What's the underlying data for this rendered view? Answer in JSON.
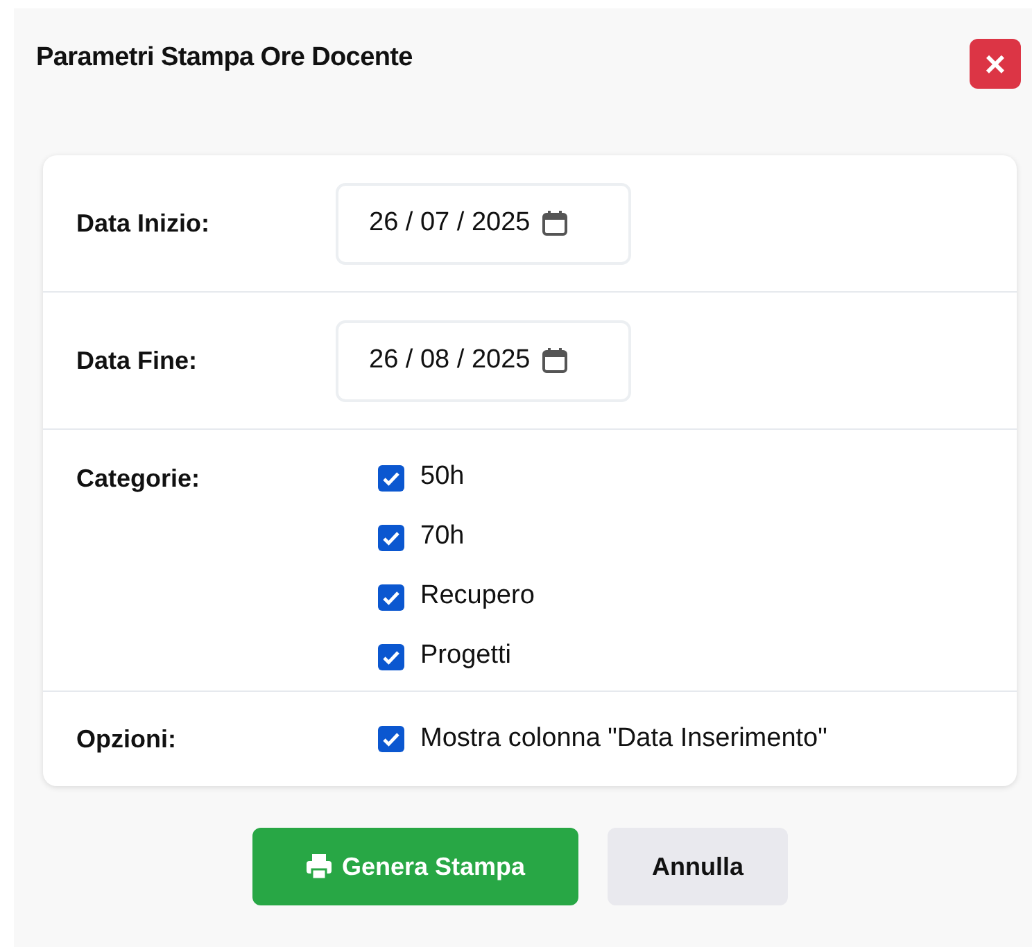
{
  "dialog": {
    "title": "Parametri Stampa Ore Docente",
    "close_label": "×"
  },
  "fields": [
    {
      "kind": "date",
      "label": "Data Inizio:",
      "value": "26 / 07 / 2025"
    },
    {
      "kind": "date",
      "label": "Data Fine:",
      "value": "26 / 08 / 2025"
    },
    {
      "kind": "checks",
      "label": "Categorie:",
      "options": [
        {
          "label": "50h",
          "checked": true
        },
        {
          "label": "70h",
          "checked": true
        },
        {
          "label": "Recupero",
          "checked": true
        },
        {
          "label": "Progetti",
          "checked": true
        }
      ]
    },
    {
      "kind": "checks",
      "label": "Opzioni:",
      "options": [
        {
          "label": "Mostra colonna \"Data Inserimento\"",
          "checked": true
        }
      ]
    }
  ],
  "buttons": [
    {
      "kind": "primary",
      "label": "Genera Stampa"
    },
    {
      "kind": "secondary",
      "label": "Annulla"
    }
  ]
}
